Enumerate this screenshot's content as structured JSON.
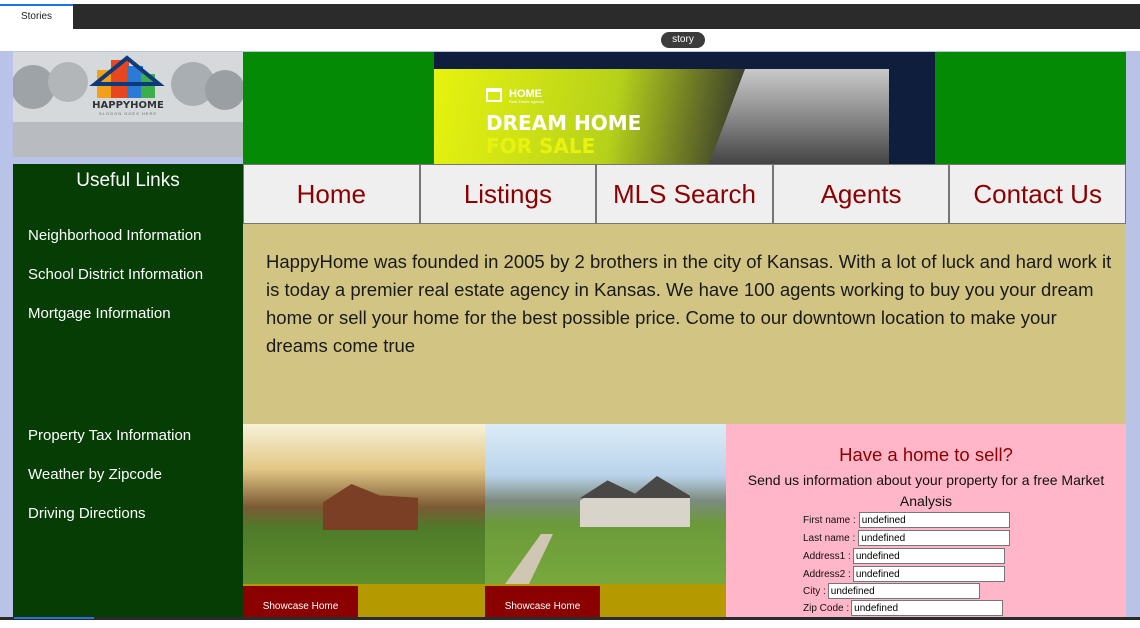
{
  "browser": {
    "tab_label": "Stories",
    "story_pill": "story"
  },
  "logo": {
    "brand": "HAPPYHOME",
    "slogan": "SLOGON GOES HERE"
  },
  "banner": {
    "home_label": "HOME",
    "home_sub": "Real Estate Agency",
    "line1": "DREAM HOME",
    "line2": "FOR SALE"
  },
  "sidebar": {
    "title": "Useful Links",
    "links": [
      "Neighborhood Information",
      "School District Information",
      "Mortgage Information",
      "Property Tax Information",
      "Weather by Zipcode",
      "Driving Directions"
    ]
  },
  "nav": {
    "items": [
      "Home",
      "Listings",
      "MLS Search",
      "Agents",
      "Contact Us"
    ]
  },
  "about": {
    "text": "HappyHome was founded in 2005 by 2 brothers in the city of Kansas. With a lot of luck and hard work it is today a premier real estate agency in Kansas. We have 100 agents working to buy you your dream home or sell your home for the best possible price. Come to our downtown location to make your dreams come true"
  },
  "showcase": {
    "button_label_1": "Showcase Home",
    "button_label_2": "Showcase Home"
  },
  "sell_form": {
    "title": "Have a home to sell?",
    "subtitle": "Send us information about your property for a free Market Analysis",
    "fields": [
      {
        "label": "First name :",
        "value": "undefined"
      },
      {
        "label": "Last name :",
        "value": "undefined"
      },
      {
        "label": "Address1 :",
        "value": "undefined"
      },
      {
        "label": "Address2 :",
        "value": "undefined"
      },
      {
        "label": "City :",
        "value": "undefined"
      },
      {
        "label": "Zip Code :",
        "value": "undefined"
      }
    ]
  },
  "colors": {
    "sidebar_bg": "#053d05",
    "banner_bg": "#048a04",
    "nav_text": "#8b0000",
    "about_bg": "#d2c483",
    "sell_bg": "#ffb6c8",
    "showcase_bar": "#b49a00",
    "showcase_button": "#8b0000"
  }
}
